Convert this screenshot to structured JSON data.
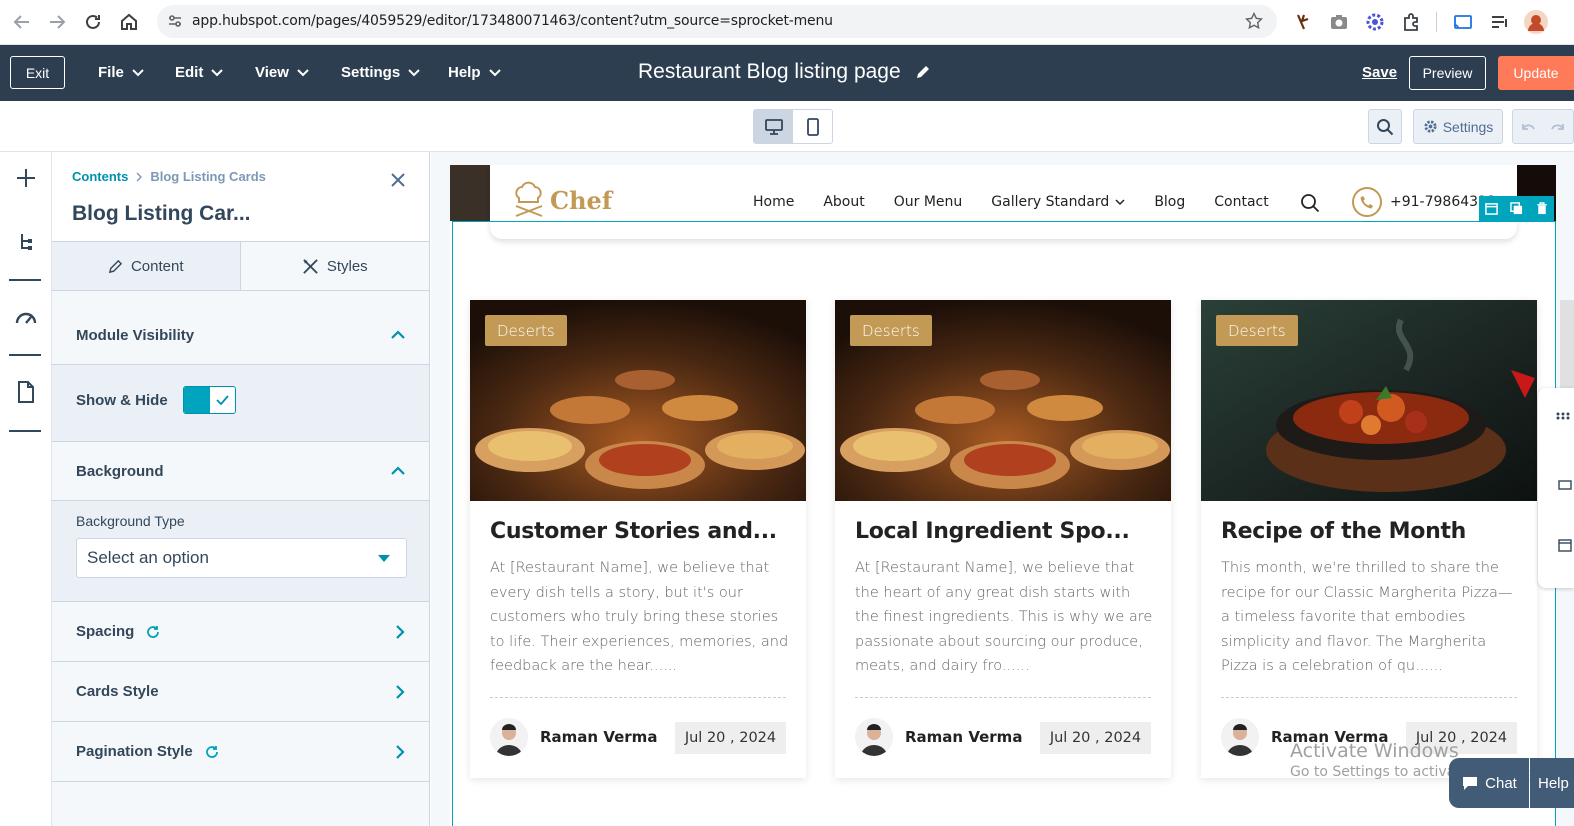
{
  "browser": {
    "url": "app.hubspot.com/pages/4059529/editor/173480071463/content?utm_source=sprocket-menu"
  },
  "header": {
    "exit": "Exit",
    "menus": [
      "File",
      "Edit",
      "View",
      "Settings",
      "Help"
    ],
    "page_title": "Restaurant Blog listing page",
    "save": "Save",
    "preview": "Preview",
    "update": "Update"
  },
  "toolbar": {
    "settings": "Settings"
  },
  "sidebar": {
    "breadcrumb_root": "Contents",
    "breadcrumb_current": "Blog Listing Cards",
    "title": "Blog Listing Car...",
    "tab_content": "Content",
    "tab_styles": "Styles",
    "sections": {
      "module_visibility": "Module Visibility",
      "show_hide": "Show & Hide",
      "background": "Background",
      "background_type_label": "Background Type",
      "background_type_value": "Select an option",
      "spacing": "Spacing",
      "cards_style": "Cards Style",
      "pagination_style": "Pagination Style"
    }
  },
  "site": {
    "logo": "Chef",
    "nav": [
      "Home",
      "About",
      "Our Menu",
      "Gallery Standard",
      "Blog",
      "Contact"
    ],
    "phone": "+91-79864323",
    "cards": [
      {
        "tag": "Deserts",
        "title": "Customer Stories and...",
        "body": "At [Restaurant Name], we believe that every dish tells a story, but it's our customers who truly bring these stories to life. Their experiences, memories, and feedback are the hear......",
        "author": "Raman Verma",
        "date": "Jul 20 , 2024"
      },
      {
        "tag": "Deserts",
        "title": "Local Ingredient Spo...",
        "body": "At [Restaurant Name], we believe that the heart of any great dish starts with the finest ingredients. This is why we are passionate about sourcing our produce, meats, and dairy fro......",
        "author": "Raman Verma",
        "date": "Jul 20 , 2024"
      },
      {
        "tag": "Deserts",
        "title": "Recipe of the Month",
        "body": "This month, we're thrilled to share the recipe for our Classic Margherita Pizza—a timeless favorite that embodies simplicity and flavor. The Margherita Pizza is a celebration of qu......",
        "author": "Raman Verma",
        "date": "Jul 20 , 2024"
      }
    ]
  },
  "overlay": {
    "activate_title": "Activate Windows",
    "activate_sub": "Go to Settings to activate Windows.",
    "chat": "Chat",
    "help": "Help"
  },
  "colors": {
    "hubspot_header": "#2d3e50",
    "update_button": "#ff7a59",
    "teal_accent": "#00a4bd",
    "site_gold": "#c29955"
  }
}
